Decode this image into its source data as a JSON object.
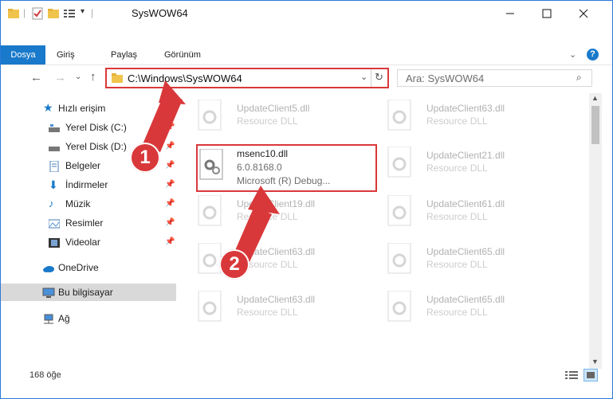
{
  "window": {
    "title": "SysWOW64"
  },
  "ribbon": {
    "tabs": [
      "Dosya",
      "Giriş",
      "Paylaş",
      "Görünüm"
    ]
  },
  "address": {
    "path": "C:\\Windows\\SysWOW64"
  },
  "search": {
    "placeholder": "Ara: SysWOW64"
  },
  "sidebar": {
    "quick_access": "Hızlı erişim",
    "items": [
      {
        "label": "Yerel Disk (C:)",
        "pinned": true
      },
      {
        "label": "Yerel Disk (D:)",
        "pinned": true
      },
      {
        "label": "Belgeler",
        "pinned": true
      },
      {
        "label": "İndirmeler",
        "pinned": true
      },
      {
        "label": "Müzik",
        "pinned": true
      },
      {
        "label": "Resimler",
        "pinned": true
      },
      {
        "label": "Videolar",
        "pinned": true
      }
    ],
    "onedrive": "OneDrive",
    "this_pc": "Bu bilgisayar",
    "network": "Ağ"
  },
  "files": {
    "highlighted": {
      "name": "msenc10.dll",
      "version": "6.0.8168.0",
      "company": "Microsoft (R) Debug..."
    },
    "background": [
      {
        "name": "UpdateClient5.dll",
        "desc": "Resource DLL"
      },
      {
        "name": "UpdateClient63.dll",
        "desc": "Resource DLL"
      },
      {
        "name": "UpdateClient21.dll",
        "desc": "Resource DLL"
      },
      {
        "name": "UpdateClient19.dll",
        "desc": "Resource DLL"
      },
      {
        "name": "UpdateClient61.dll",
        "desc": "Resource DLL"
      },
      {
        "name": "UpdateClient63.dll",
        "desc": "Resource DLL"
      },
      {
        "name": "UpdateClient65.dll",
        "desc": "Resource DLL"
      },
      {
        "name": "UpdateClient63.dll",
        "desc": "Resource DLL"
      },
      {
        "name": "UpdateClient65.dll",
        "desc": "Resource DLL"
      }
    ]
  },
  "status": {
    "count": "168 öğe"
  },
  "annotations": {
    "step1": "1",
    "step2": "2"
  },
  "colors": {
    "accent": "#1979ca",
    "highlight": "#d9383a"
  }
}
